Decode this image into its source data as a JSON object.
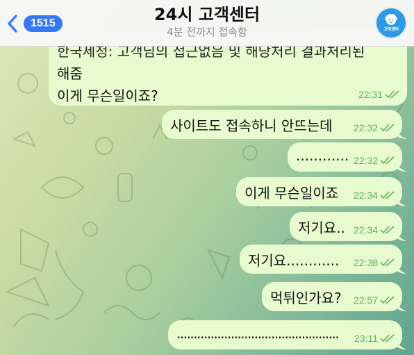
{
  "header": {
    "back_count": "1515",
    "title": "24시 고객센터",
    "subtitle": "4분 전까지 접속함",
    "avatar_label": "고객센터"
  },
  "messages": [
    {
      "lines": [
        "한국세청: 고객님의 접근없음 및 해당처리 결과처리된",
        "해줌",
        "이게 무슨일이죠?"
      ],
      "time": "22:31"
    },
    {
      "lines": [
        "사이트도 접속하니 안뜨는데"
      ],
      "time": "22:32"
    },
    {
      "lines": [
        "............"
      ],
      "time": "22:32"
    },
    {
      "lines": [
        "이게 무슨일이죠"
      ],
      "time": "22:34"
    },
    {
      "lines": [
        "저기요.."
      ],
      "time": "22:34"
    },
    {
      "lines": [
        "저기요............"
      ],
      "time": "22:38"
    },
    {
      "lines": [
        "먹튀인가요?"
      ],
      "time": "22:57"
    },
    {
      "lines": [
        "................................................"
      ],
      "time": "23:11"
    }
  ],
  "colors": {
    "bubble": "#e8fbce",
    "time": "#5fb05a",
    "accent": "#3478f6"
  }
}
